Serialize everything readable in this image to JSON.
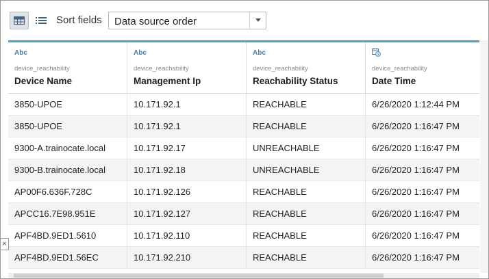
{
  "toolbar": {
    "sort_label": "Sort fields",
    "sort_value": "Data source order",
    "grid_view_icon": "grid-view-icon",
    "list_view_icon": "list-view-icon"
  },
  "columns": [
    {
      "type": "Abc",
      "source": "device_reachability",
      "name": "Device Name",
      "icon": "text-type-icon"
    },
    {
      "type": "Abc",
      "source": "device_reachability",
      "name": "Management Ip",
      "icon": "text-type-icon"
    },
    {
      "type": "Abc",
      "source": "device_reachability",
      "name": "Reachability Status",
      "icon": "text-type-icon"
    },
    {
      "type": "",
      "source": "device_reachability",
      "name": "Date Time",
      "icon": "datetime-type-icon"
    }
  ],
  "rows": [
    [
      "3850-UPOE",
      "10.171.92.1",
      "REACHABLE",
      "6/26/2020 1:12:44 PM"
    ],
    [
      "3850-UPOE",
      "10.171.92.1",
      "REACHABLE",
      "6/26/2020 1:16:47 PM"
    ],
    [
      "9300-A.trainocate.local",
      "10.171.92.17",
      "UNREACHABLE",
      "6/26/2020 1:16:47 PM"
    ],
    [
      "9300-B.trainocate.local",
      "10.171.92.18",
      "UNREACHABLE",
      "6/26/2020 1:16:47 PM"
    ],
    [
      "AP00F6.636F.728C",
      "10.171.92.126",
      "REACHABLE",
      "6/26/2020 1:16:47 PM"
    ],
    [
      "APCC16.7E98.951E",
      "10.171.92.127",
      "REACHABLE",
      "6/26/2020 1:16:47 PM"
    ],
    [
      "APF4BD.9ED1.5610",
      "10.171.92.110",
      "REACHABLE",
      "6/26/2020 1:16:47 PM"
    ],
    [
      "APF4BD.9ED1.56EC",
      "10.171.92.210",
      "REACHABLE",
      "6/26/2020 1:16:47 PM"
    ]
  ],
  "side_tab": {
    "icon": "close-icon",
    "glyph": "×"
  },
  "colors": {
    "accent": "#4aa0c9",
    "type_label": "#3b7fb6",
    "alt_row": "#f4f4f4"
  }
}
